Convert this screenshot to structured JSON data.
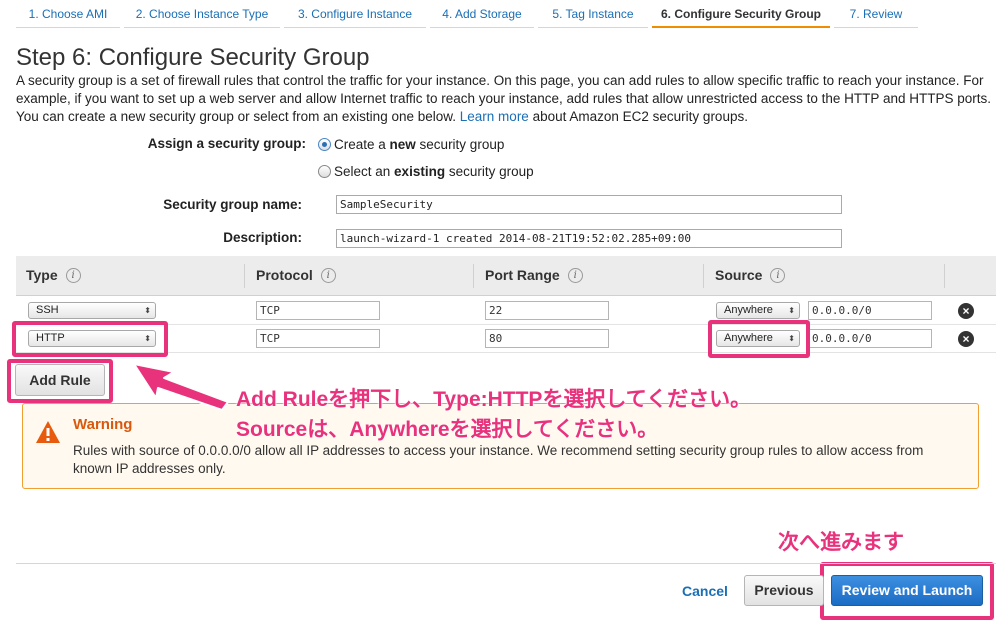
{
  "wizard_tabs": [
    "1. Choose AMI",
    "2. Choose Instance Type",
    "3. Configure Instance",
    "4. Add Storage",
    "5. Tag Instance",
    "6. Configure Security Group",
    "7. Review"
  ],
  "page": {
    "title": "Step 6: Configure Security Group",
    "intro": "A security group is a set of firewall rules that control the traffic for your instance. On this page, you can add rules to allow specific traffic to reach your instance. For example, if you want to set up a web server and allow Internet traffic to reach your instance, add rules that allow unrestricted access to the HTTP and HTTPS ports. You can create a new security group or select from an existing one below.",
    "learn_more": "Learn more",
    "intro_tail": "about Amazon EC2 security groups."
  },
  "form": {
    "assign_label": "Assign a security group:",
    "option_new_pre": "Create a ",
    "option_new_bold": "new",
    "option_new_post": " security group",
    "option_existing_pre": "Select an ",
    "option_existing_bold": "existing",
    "option_existing_post": " security group",
    "name_label": "Security group name:",
    "name_value": "SampleSecurity",
    "desc_label": "Description:",
    "desc_value": "launch-wizard-1 created 2014-08-21T19:52:02.285+09:00"
  },
  "table": {
    "headers": [
      "Type",
      "Protocol",
      "Port Range",
      "Source"
    ],
    "info_glyph": "i",
    "rows": [
      {
        "type": "SSH",
        "protocol": "TCP",
        "port": "22",
        "source": "Anywhere",
        "cidr": "0.0.0.0/0"
      },
      {
        "type": "HTTP",
        "protocol": "TCP",
        "port": "80",
        "source": "Anywhere",
        "cidr": "0.0.0.0/0"
      }
    ],
    "select_arrow": "⬍",
    "remove_glyph": "×"
  },
  "add_rule_label": "Add Rule",
  "warning": {
    "title": "Warning",
    "text": "Rules with source of 0.0.0.0/0 allow all IP addresses to access your instance. We recommend setting security group rules to allow access from known IP addresses only."
  },
  "annotations": {
    "line1": "Add Ruleを押下し、Type:HTTPを選択してください。",
    "line2": "Sourceは、Anywhereを選択してください。",
    "next": "次へ進みます",
    "color": "#e8327c"
  },
  "footer": {
    "cancel": "Cancel",
    "previous": "Previous",
    "review_launch": "Review and Launch"
  },
  "icons": {
    "warning": "warning-triangle-icon",
    "info": "info-circle-icon",
    "remove": "remove-circle-icon",
    "arrow": "pink-arrow-icon"
  }
}
